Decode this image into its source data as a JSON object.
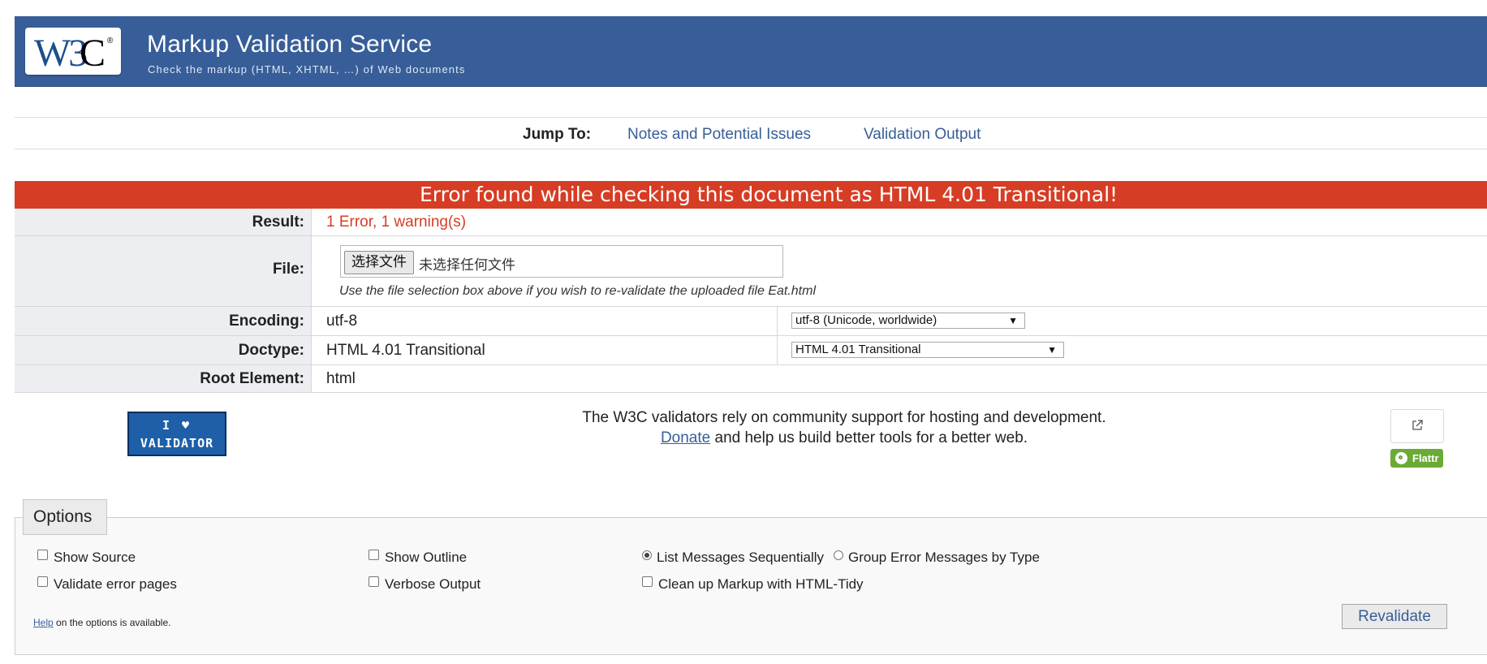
{
  "header": {
    "logo_text": "W3C",
    "title": "Markup Validation Service",
    "subtitle": "Check the markup (HTML, XHTML, …) of Web documents",
    "color": "#375e98"
  },
  "jump": {
    "label": "Jump To:",
    "links": [
      "Notes and Potential Issues",
      "Validation Output"
    ]
  },
  "banner": {
    "text": "Error found while checking this document as HTML 4.01 Transitional!",
    "color": "#d63d24"
  },
  "result": {
    "label": "Result:",
    "value": "1 Error, 1 warning(s)"
  },
  "file": {
    "label": "File:",
    "button": "选择文件",
    "status": "未选择任何文件",
    "note": "Use the file selection box above if you wish to re-validate the uploaded file Eat.html"
  },
  "encoding": {
    "label": "Encoding:",
    "value": "utf-8",
    "select": "utf-8 (Unicode, worldwide)"
  },
  "doctype": {
    "label": "Doctype:",
    "value": "HTML 4.01 Transitional",
    "select": "HTML 4.01 Transitional"
  },
  "root": {
    "label": "Root Element:",
    "value": "html"
  },
  "badge": {
    "line1": "I ♥",
    "line2": "VALIDATOR"
  },
  "support": {
    "line1": "The W3C validators rely on community support for hosting and development.",
    "donate": "Donate",
    "line2": "and help us build better tools for a better web."
  },
  "flattr": {
    "label": "Flattr",
    "color": "#6aab35"
  },
  "options": {
    "title": "Options",
    "show_source": "Show Source",
    "show_outline": "Show Outline",
    "list_sequential": "List Messages Sequentially",
    "group_by_type": "Group Error Messages by Type",
    "validate_error_pages": "Validate error pages",
    "verbose_output": "Verbose Output",
    "cleanup_tidy": "Clean up Markup with HTML-Tidy",
    "help_link": "Help",
    "help_text": "on the options is available.",
    "revalidate": "Revalidate"
  }
}
